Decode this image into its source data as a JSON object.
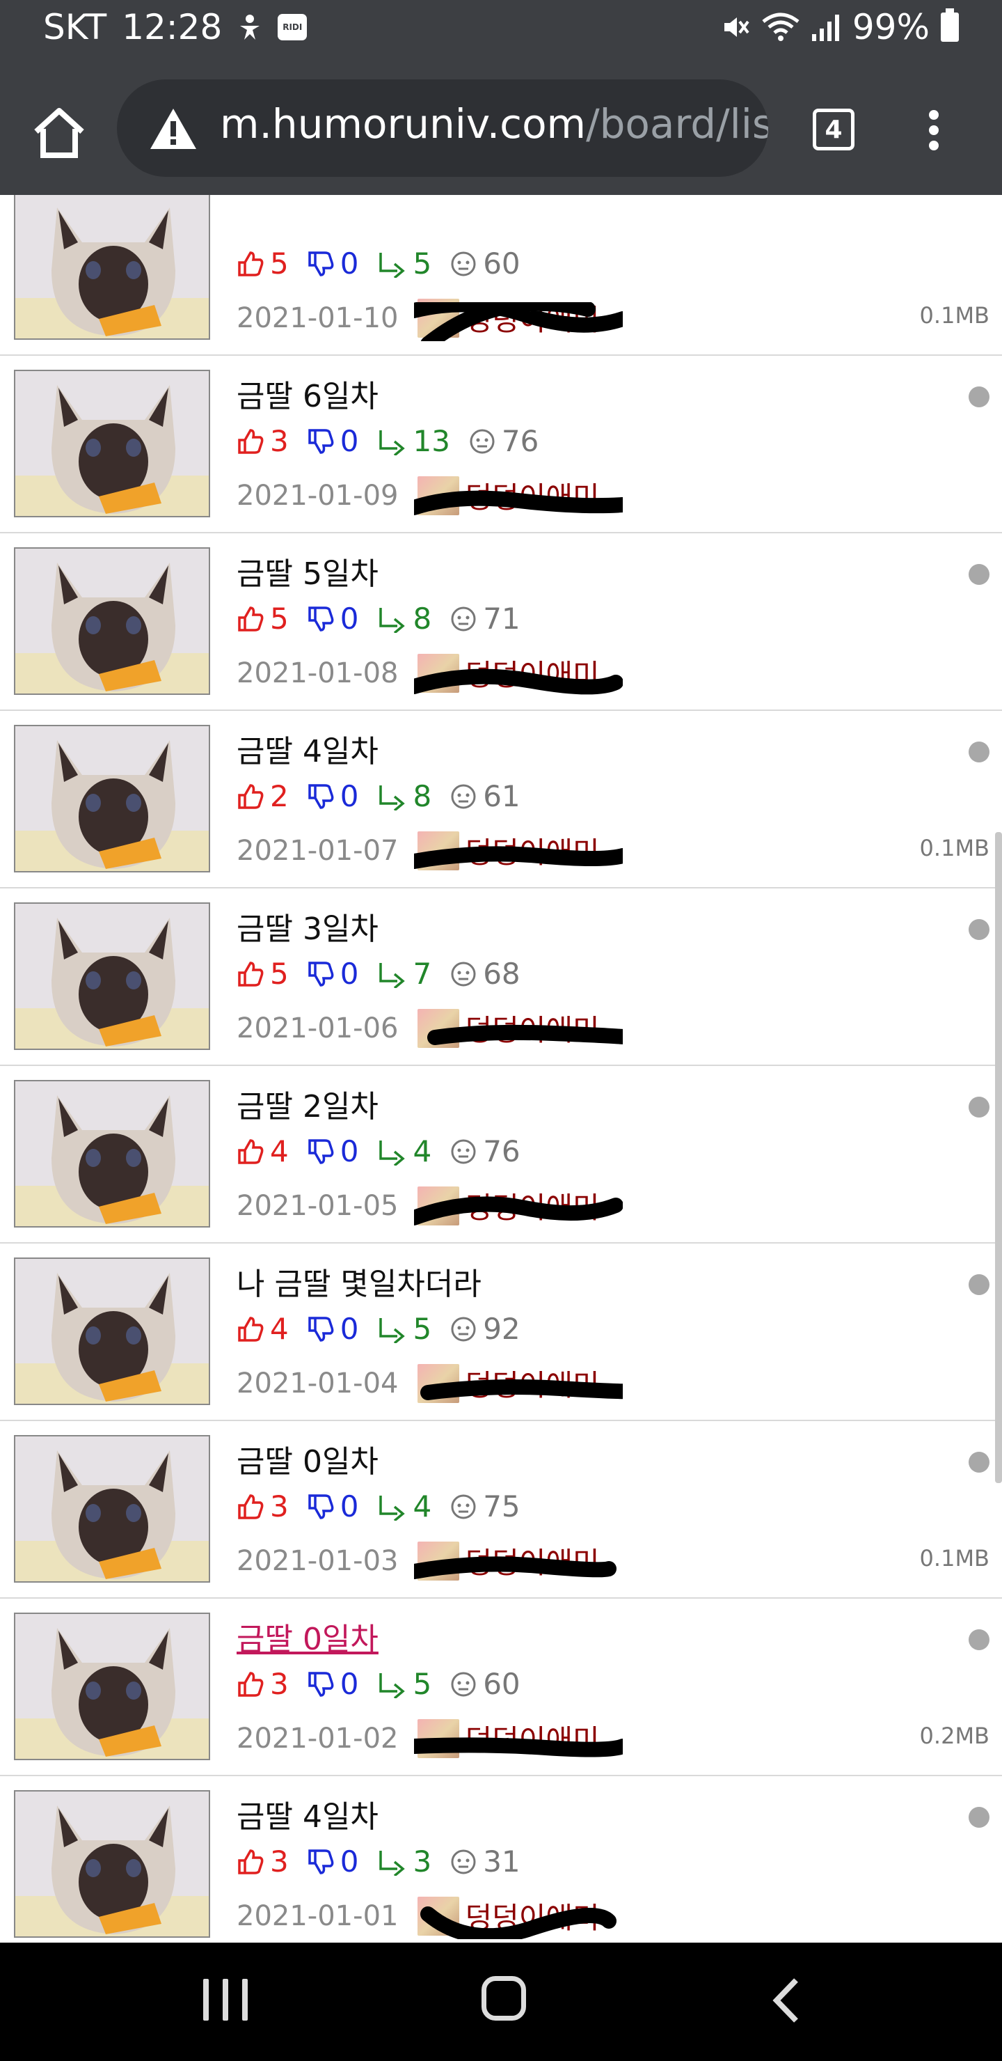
{
  "status_bar": {
    "carrier": "SKT",
    "time": "12:28",
    "app_badge": "RIDI",
    "battery": "99%"
  },
  "browser": {
    "url_host": "m.humoruniv.com",
    "url_path": "/board/lis",
    "tab_count": "4"
  },
  "posts": [
    {
      "title": "",
      "up": "5",
      "down": "0",
      "reply": "5",
      "views": "60",
      "date": "2021-01-10",
      "author": "덩덩이애미",
      "size": "0.1MB"
    },
    {
      "title": "금딸 6일차",
      "up": "3",
      "down": "0",
      "reply": "13",
      "views": "76",
      "date": "2021-01-09",
      "author": "덩덩이애미",
      "size": ""
    },
    {
      "title": "금딸 5일차",
      "up": "5",
      "down": "0",
      "reply": "8",
      "views": "71",
      "date": "2021-01-08",
      "author": "덩덩이애미",
      "size": ""
    },
    {
      "title": "금딸 4일차",
      "up": "2",
      "down": "0",
      "reply": "8",
      "views": "61",
      "date": "2021-01-07",
      "author": "덩덩이애미",
      "size": "0.1MB"
    },
    {
      "title": "금딸 3일차",
      "up": "5",
      "down": "0",
      "reply": "7",
      "views": "68",
      "date": "2021-01-06",
      "author": "덩덩이애미",
      "size": ""
    },
    {
      "title": "금딸 2일차",
      "up": "4",
      "down": "0",
      "reply": "4",
      "views": "76",
      "date": "2021-01-05",
      "author": "덩덩이애미",
      "size": ""
    },
    {
      "title": "나 금딸 몇일차더라",
      "up": "4",
      "down": "0",
      "reply": "5",
      "views": "92",
      "date": "2021-01-04",
      "author": "덩덩이애미",
      "size": ""
    },
    {
      "title": "금딸 0일차",
      "up": "3",
      "down": "0",
      "reply": "4",
      "views": "75",
      "date": "2021-01-03",
      "author": "덩덩이애미",
      "size": "0.1MB"
    },
    {
      "title": "금딸 0일차",
      "up": "3",
      "down": "0",
      "reply": "5",
      "views": "60",
      "date": "2021-01-02",
      "author": "덩덩이애미",
      "size": "0.2MB"
    },
    {
      "title": "금딸 4일차",
      "up": "3",
      "down": "0",
      "reply": "3",
      "views": "31",
      "date": "2021-01-01",
      "author": "덩덩이애미",
      "size": ""
    }
  ],
  "colors": {
    "upvote": "#e0201f",
    "downvote": "#1a2ad8",
    "reply": "#21862a",
    "visited_link": "#c2185b",
    "author": "#8b0000"
  },
  "icons": [
    "home-icon",
    "warning-icon",
    "tabs-icon",
    "more-vert-icon",
    "thumb-up-icon",
    "thumb-down-icon",
    "reply-icon",
    "views-icon",
    "unread-dot-icon"
  ]
}
